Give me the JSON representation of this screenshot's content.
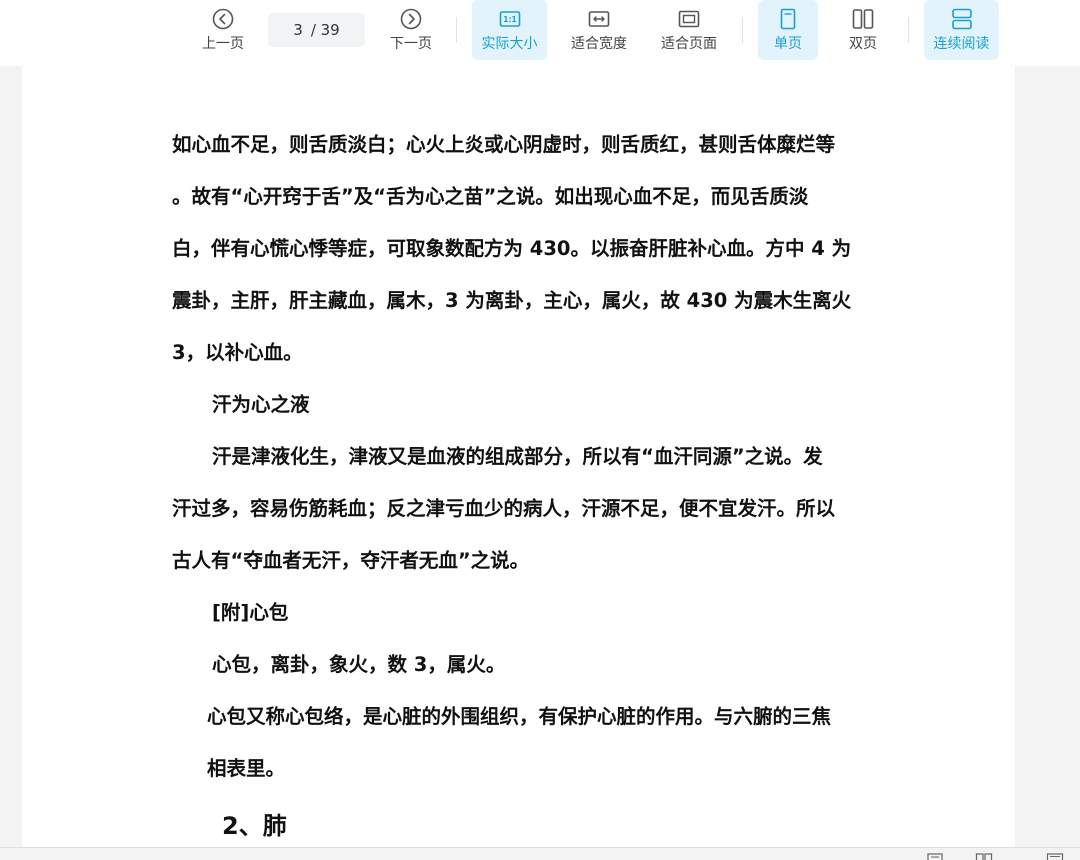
{
  "toolbar": {
    "prev_label": "上一页",
    "next_label": "下一页",
    "page_current": "3",
    "page_total": "/ 39",
    "actual_size_label": "实际大小",
    "fit_width_label": "适合宽度",
    "fit_page_label": "适合页面",
    "single_page_label": "单页",
    "double_page_label": "双页",
    "continuous_label": "连续阅读",
    "actual_size_icon_text": "1:1",
    "active_color": "#1a9fd4",
    "active_bg": "#e3f3fb"
  },
  "document": {
    "lines": [
      "如心血不足，则舌质淡白；心火上炎或心阴虚时，则舌质红，甚则舌体糜烂等",
      "。故有“心开窍于舌”及“舌为心之苗”之说。如出现心血不足，而见舌质淡",
      "白，伴有心慌心悸等症，可取象数配方为 430。以振奋肝脏补心血。方中 4 为",
      "震卦，主肝，肝主藏血，属木，3 为离卦，主心，属火，故 430 为震木生离火",
      "3，以补心血。",
      "汗为心之液",
      "汗是津液化生，津液又是血液的组成部分，所以有“血汗同源”之说。发",
      "汗过多，容易伤筋耗血；反之津亏血少的病人，汗源不足，便不宜发汗。所以",
      "古人有“夺血者无汗，夺汗者无血”之说。",
      "[附]心包",
      "心包，离卦，象火，数 3，属火。",
      "心包又称心包络，是心脏的外围组织，有保护心脏的作用。与六腑的三焦",
      "相表里。"
    ],
    "heading": "2、肺"
  },
  "icons": {
    "prev": "chevron-left-circle-icon",
    "next": "chevron-right-circle-icon",
    "actual_size": "one-to-one-icon",
    "fit_width": "fit-width-icon",
    "fit_page": "fit-page-icon",
    "single_page": "single-page-icon",
    "double_page": "double-page-icon",
    "continuous": "continuous-scroll-icon"
  }
}
